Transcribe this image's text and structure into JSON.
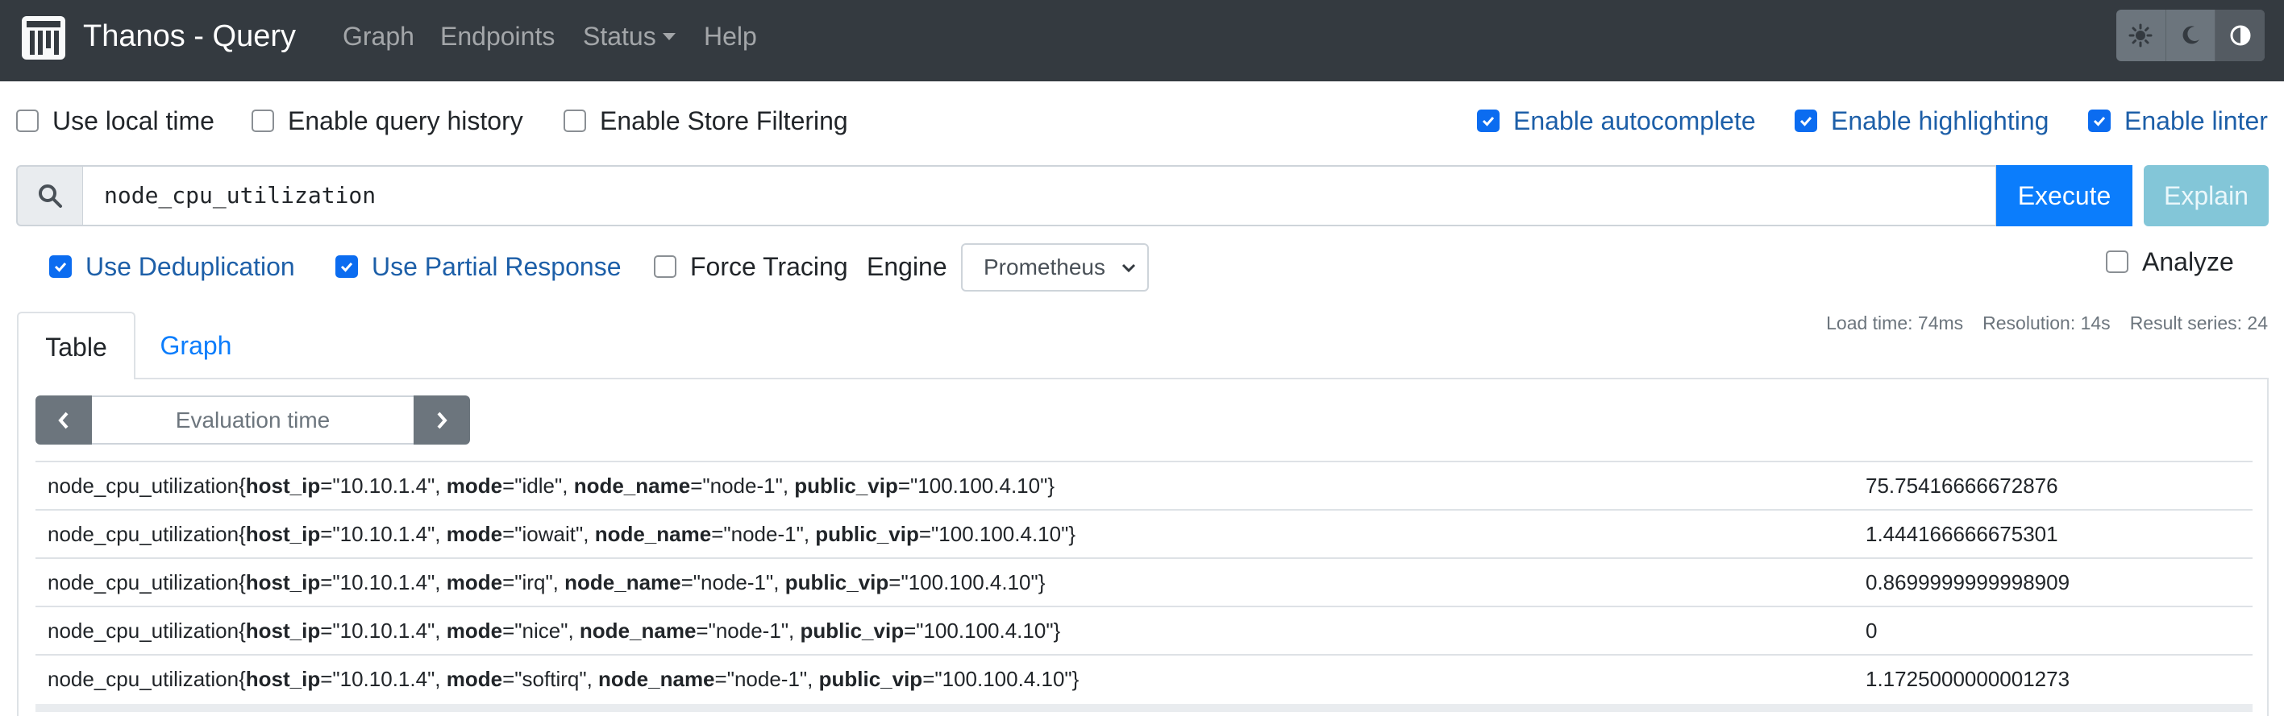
{
  "navbar": {
    "title": "Thanos - Query",
    "links": [
      "Graph",
      "Endpoints",
      "Status",
      "Help"
    ],
    "theme_icons": [
      "sun-icon",
      "moon-icon",
      "contrast-icon"
    ]
  },
  "options_top": {
    "use_local_time": {
      "label": "Use local time",
      "checked": false
    },
    "enable_query_history": {
      "label": "Enable query history",
      "checked": false
    },
    "enable_store_filtering": {
      "label": "Enable Store Filtering",
      "checked": false
    },
    "enable_autocomplete": {
      "label": "Enable autocomplete",
      "checked": true
    },
    "enable_highlighting": {
      "label": "Enable highlighting",
      "checked": true
    },
    "enable_linter": {
      "label": "Enable linter",
      "checked": true
    }
  },
  "query": {
    "value": "node_cpu_utilization",
    "execute_label": "Execute",
    "explain_label": "Explain"
  },
  "options_query": {
    "use_deduplication": {
      "label": "Use Deduplication",
      "checked": true
    },
    "use_partial_response": {
      "label": "Use Partial Response",
      "checked": true
    },
    "force_tracing": {
      "label": "Force Tracing",
      "checked": false
    },
    "engine_label": "Engine",
    "engine_value": "Prometheus",
    "analyze": {
      "label": "Analyze",
      "checked": false
    }
  },
  "stats": {
    "load_time": "Load time: 74ms",
    "resolution": "Resolution: 14s",
    "result_series": "Result series: 24"
  },
  "tabs": [
    "Table",
    "Graph"
  ],
  "eval_time": {
    "placeholder": "Evaluation time"
  },
  "results": {
    "metric": "node_cpu_utilization",
    "rows": [
      {
        "host_ip": "10.10.1.4",
        "mode": "idle",
        "node_name": "node-1",
        "public_vip": "100.100.4.10",
        "value": "75.75416666672876"
      },
      {
        "host_ip": "10.10.1.4",
        "mode": "iowait",
        "node_name": "node-1",
        "public_vip": "100.100.4.10",
        "value": "1.444166666675301"
      },
      {
        "host_ip": "10.10.1.4",
        "mode": "irq",
        "node_name": "node-1",
        "public_vip": "100.100.4.10",
        "value": "0.8699999999998909"
      },
      {
        "host_ip": "10.10.1.4",
        "mode": "nice",
        "node_name": "node-1",
        "public_vip": "100.100.4.10",
        "value": "0"
      },
      {
        "host_ip": "10.10.1.4",
        "mode": "softirq",
        "node_name": "node-1",
        "public_vip": "100.100.4.10",
        "value": "1.1725000000001273"
      }
    ]
  },
  "colors": {
    "navbar_bg": "#343a40",
    "primary": "#0b7dfc",
    "info": "#83c6d8",
    "checkbox_checked": "#0b6cf0"
  }
}
